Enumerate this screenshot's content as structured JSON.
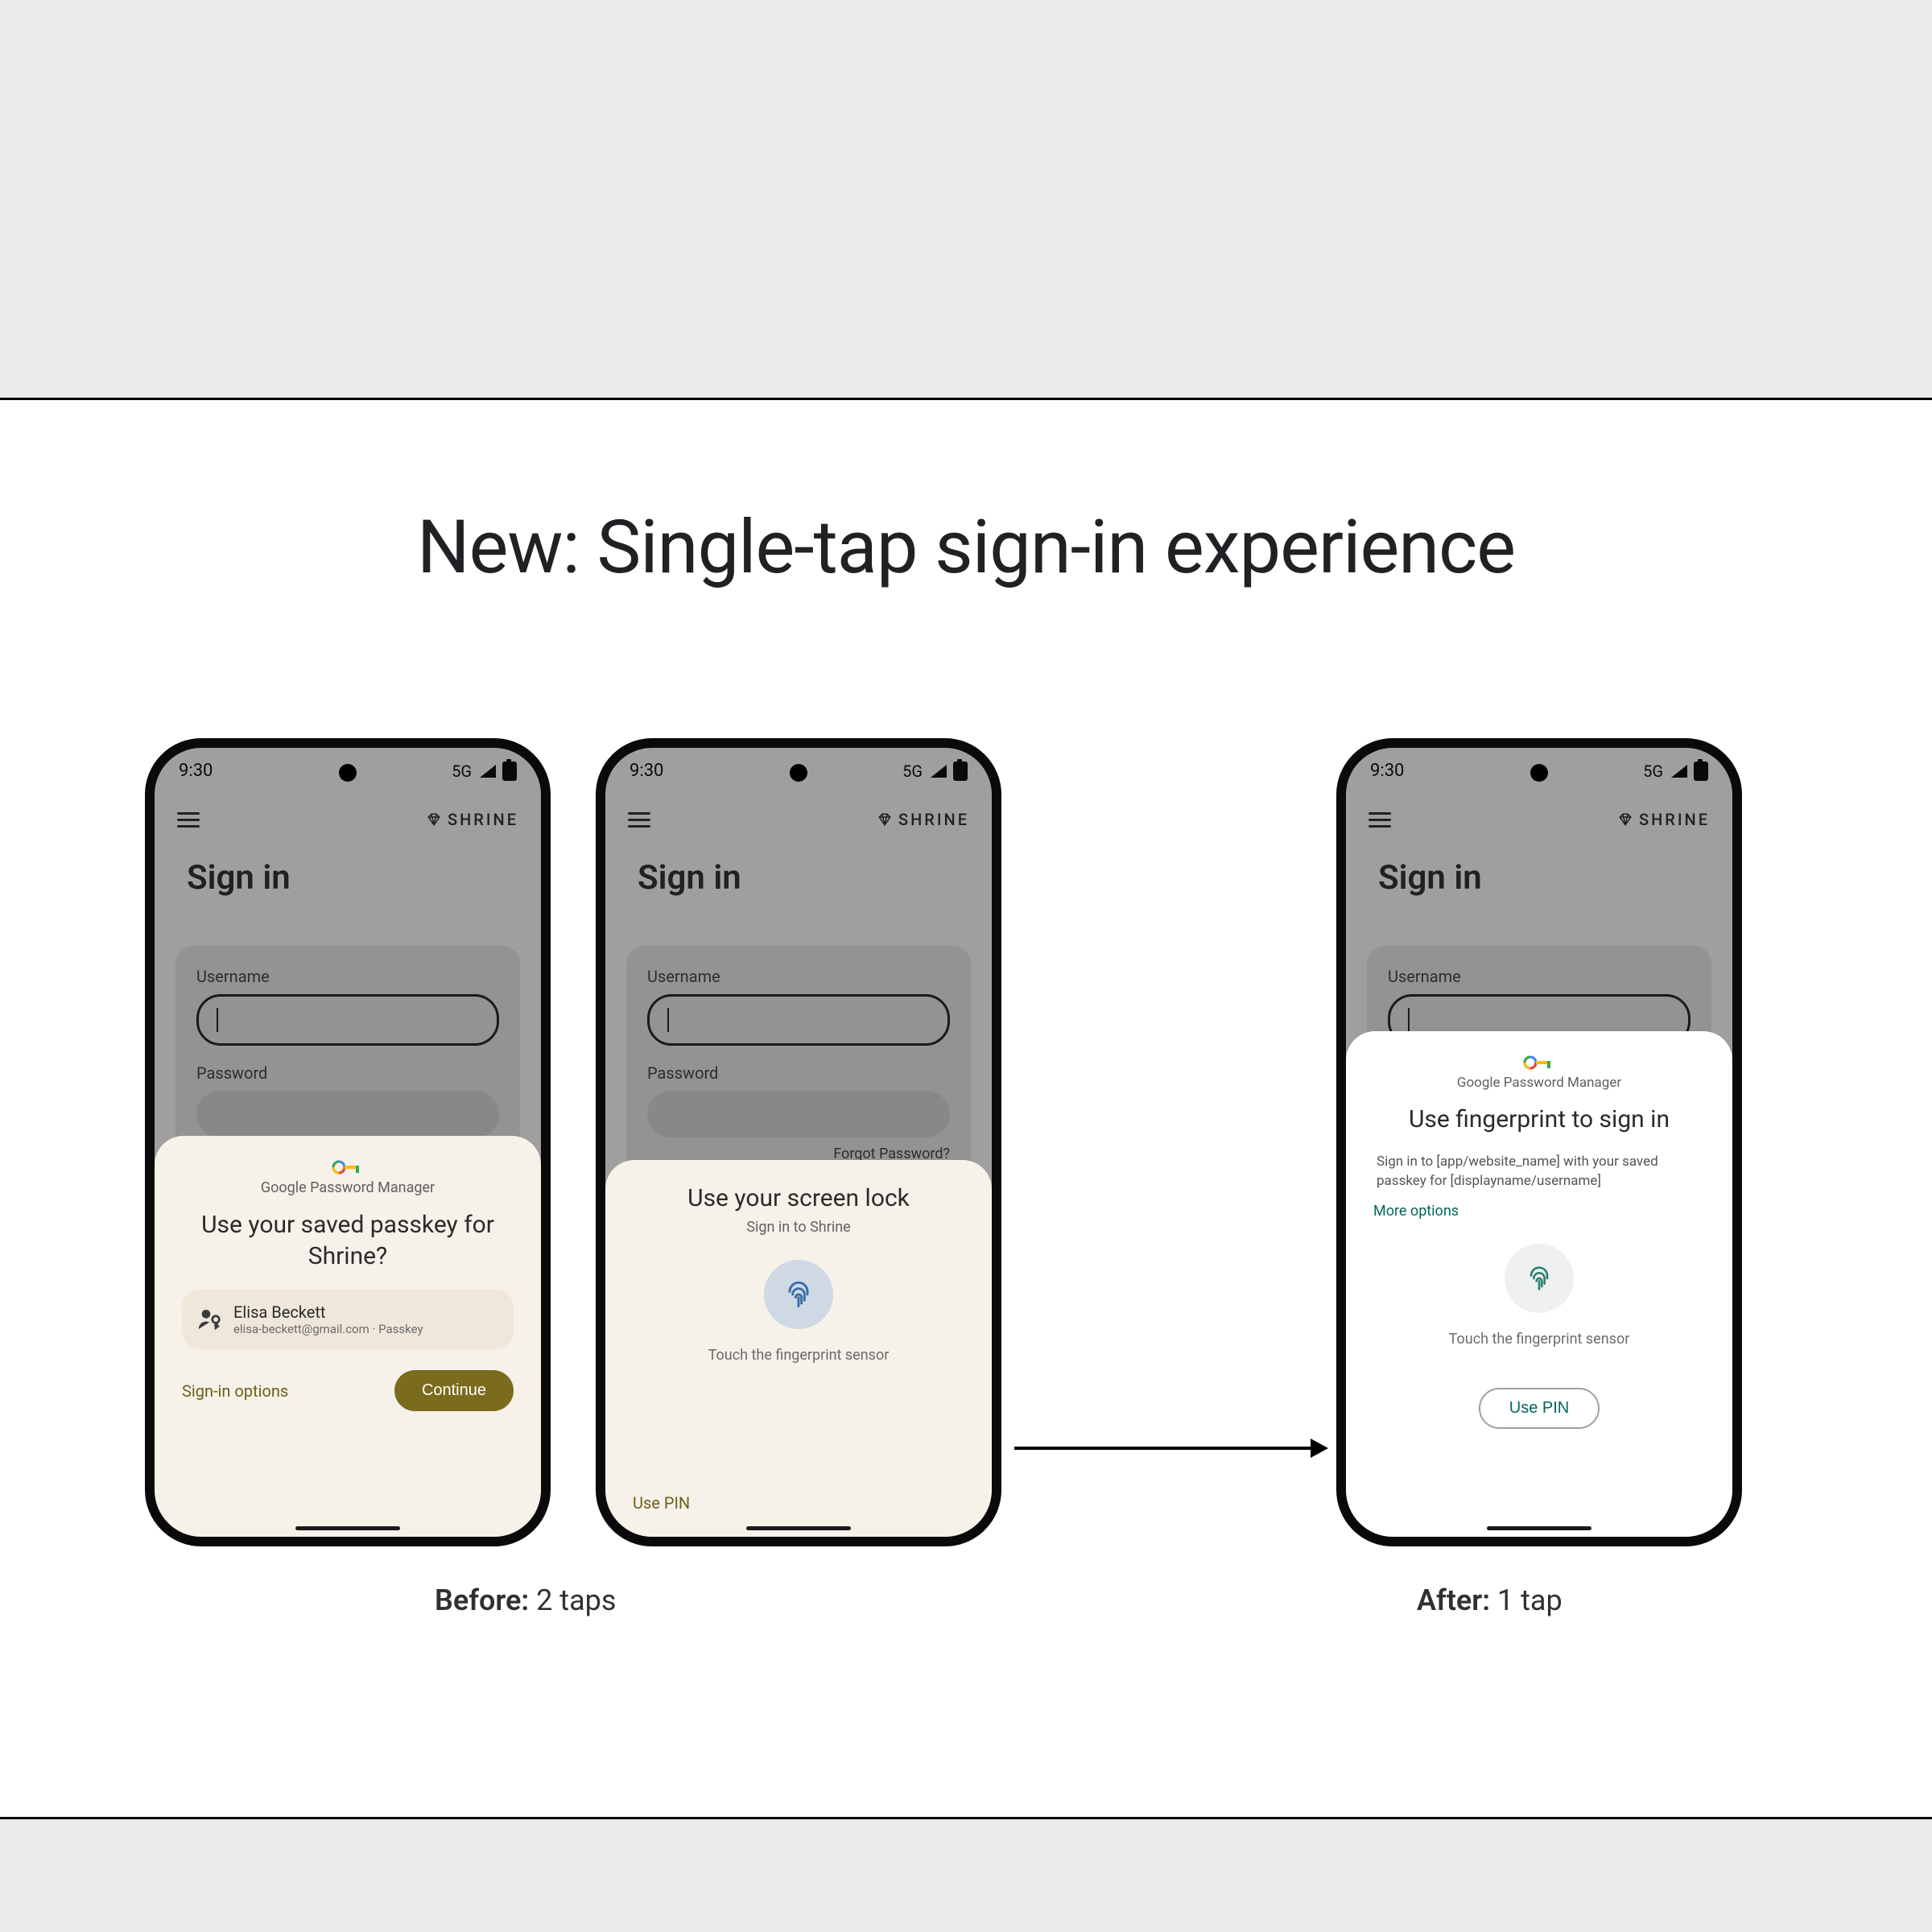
{
  "title": "New: Single-tap sign-in experience",
  "status": {
    "time": "9:30",
    "net": "5G"
  },
  "app": {
    "brand": "SHRINE"
  },
  "form": {
    "heading": "Sign in",
    "username_label": "Username",
    "password_label": "Password",
    "forgot": "Forgot Password?"
  },
  "gpm": "Google Password Manager",
  "sheet1": {
    "title": "Use your saved passkey for Shrine?",
    "account_name": "Elisa Beckett",
    "account_sub": "elisa-beckett@gmail.com · Passkey",
    "signin_options": "Sign-in options",
    "continue": "Continue"
  },
  "sheet2": {
    "title": "Use your screen lock",
    "sub": "Sign in to Shrine",
    "touch": "Touch the fingerprint sensor",
    "use_pin": "Use PIN"
  },
  "sheet3": {
    "title": "Use fingerprint to sign in",
    "body": "Sign in to [app/website_name] with your saved passkey for [displayname/username]",
    "more": "More options",
    "touch": "Touch the fingerprint sensor",
    "use_pin": "Use PIN"
  },
  "captions": {
    "before_label": "Before:",
    "before_value": " 2 taps",
    "after_label": "After:",
    "after_value": " 1 tap"
  }
}
